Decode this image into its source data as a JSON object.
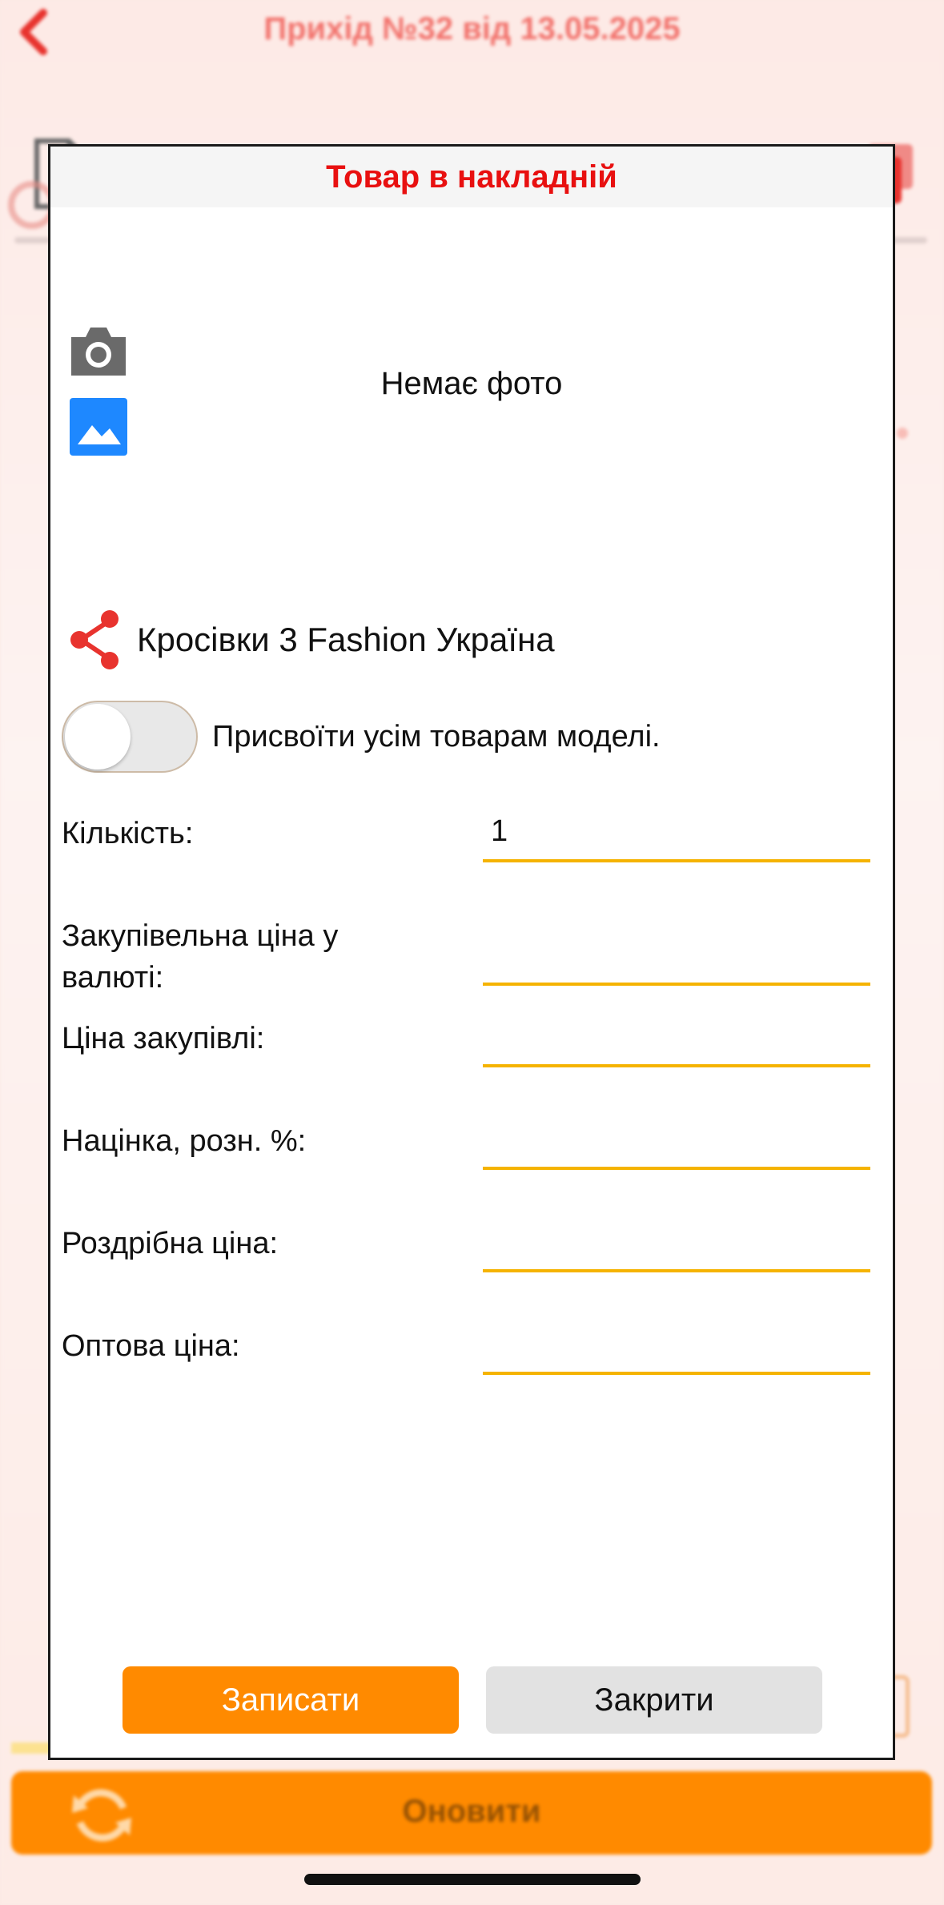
{
  "colors": {
    "accent": "#ff8a00",
    "title_red": "#e81010",
    "input_underline": "#f5b300",
    "share_icon": "#e8332e",
    "gallery_icon": "#1e88ff"
  },
  "background": {
    "header_title": "Прихід №32 від 13.05.2025",
    "refresh_label": "Оновити"
  },
  "modal": {
    "title": "Товар в накладній",
    "no_photo": "Немає фото",
    "product_name": "Кросівки 3 Fashion Україна",
    "apply_all_label": "Присвоїти усім товарам моделі.",
    "apply_all_enabled": false,
    "fields": [
      {
        "label": "Кількість:",
        "value": "1"
      },
      {
        "label": "Закупівельна ціна у валюті:",
        "value": ""
      },
      {
        "label": "Ціна закупівлі:",
        "value": ""
      },
      {
        "label": "Націнка, розн. %:",
        "value": ""
      },
      {
        "label": "Роздрібна ціна:",
        "value": ""
      },
      {
        "label": "Оптова ціна:",
        "value": ""
      }
    ],
    "save_label": "Записати",
    "close_label": "Закрити"
  },
  "icons": {
    "back": "chevron-left-icon",
    "document": "document-add-icon",
    "edit": "pencil-icon",
    "download": "download-icon",
    "search": "search-icon",
    "camera": "camera-icon",
    "gallery": "image-icon",
    "share": "share-icon",
    "refresh": "refresh-icon"
  }
}
